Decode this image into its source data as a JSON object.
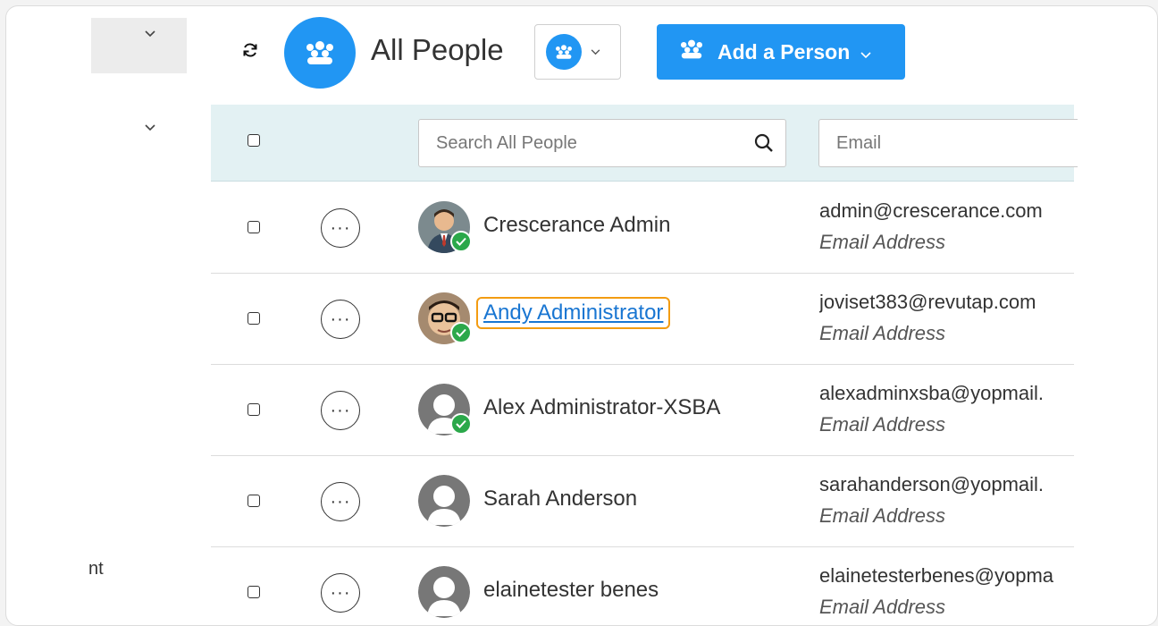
{
  "header": {
    "title": "All People",
    "add_button_label": "Add a Person"
  },
  "sidebar": {
    "partial_item_label": "nt"
  },
  "table": {
    "search_placeholder": "Search All People",
    "email_placeholder": "Email",
    "rows": [
      {
        "name": "Crescerance Admin",
        "email": "admin@crescerance.com",
        "email_sub": "Email Address",
        "verified": true,
        "avatar": "photo-man-suit"
      },
      {
        "name": "Andy Administrator",
        "email": "joviset383@revutap.com",
        "email_sub": "Email Address",
        "verified": true,
        "avatar": "photo-man-glasses",
        "highlighted": true
      },
      {
        "name": "Alex Administrator-XSBA",
        "email": "alexadminxsba@yopmail.",
        "email_sub": "Email Address",
        "verified": true,
        "avatar": "default-person"
      },
      {
        "name": "Sarah Anderson",
        "email": "sarahanderson@yopmail.",
        "email_sub": "Email Address",
        "verified": false,
        "avatar": "default-person"
      },
      {
        "name": "elainetester benes",
        "email": "elainetesterbenes@yopma",
        "email_sub": "Email Address",
        "verified": false,
        "avatar": "default-person"
      }
    ]
  },
  "colors": {
    "accent": "#2196f3",
    "verified": "#2ba84a",
    "highlight_border": "#f39c12",
    "link": "#1976d2"
  }
}
